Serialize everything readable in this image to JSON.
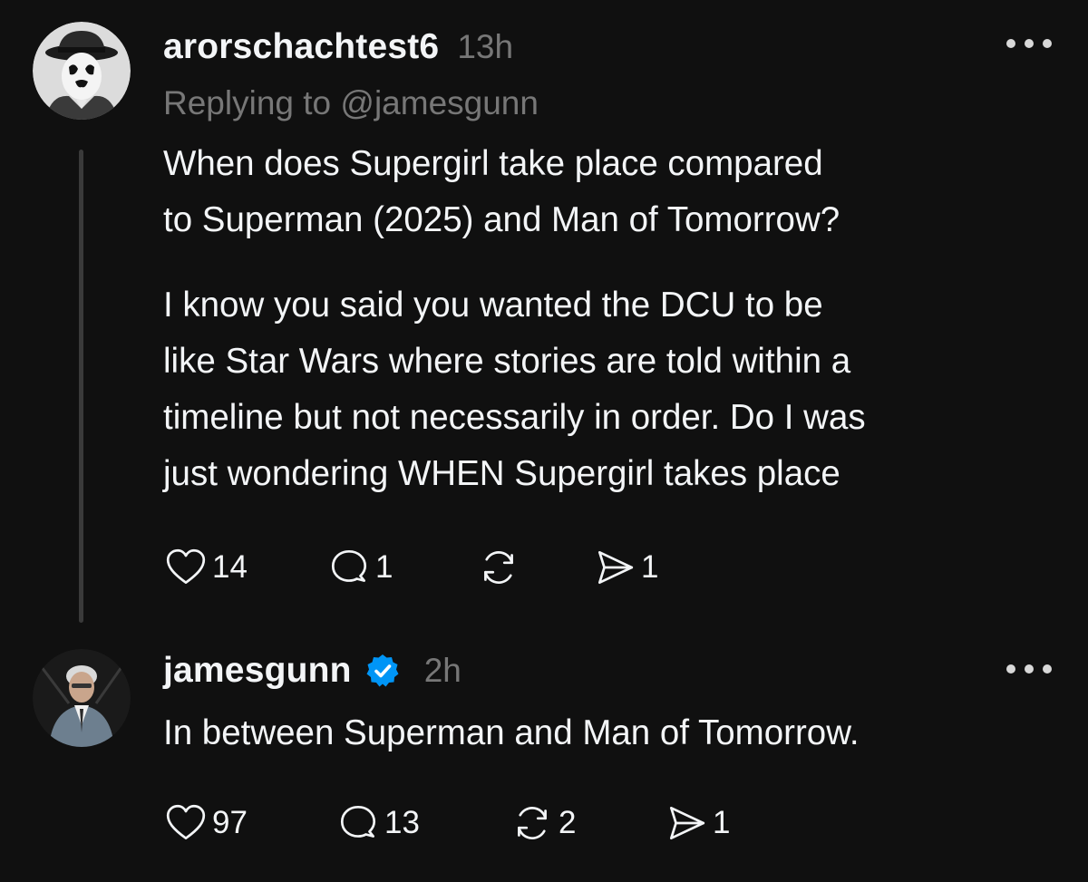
{
  "posts": [
    {
      "username": "arorschachtest6",
      "time": "13h",
      "replying_to": "Replying to @jamesgunn",
      "avatar_icon": "rorschach-avatar",
      "paragraphs": [
        [
          "When does Supergirl take place compared",
          "to Superman (2025) and Man of Tomorrow?"
        ],
        [
          "I know you said you wanted the DCU to be",
          "like Star Wars where stories are told within a",
          "timeline but not necessarily in order. Do I was",
          "just wondering WHEN Supergirl takes place"
        ]
      ],
      "likes": "14",
      "replies": "1",
      "reposts": "",
      "shares": "1"
    },
    {
      "username": "jamesgunn",
      "verified": true,
      "time": "2h",
      "avatar_icon": "profile-photo-avatar",
      "paragraphs": [
        [
          "In between Superman and Man of Tomorrow."
        ]
      ],
      "likes": "97",
      "replies": "13",
      "reposts": "2",
      "shares": "1"
    }
  ],
  "icons": {
    "like": "heart-icon",
    "reply": "speech-bubble-icon",
    "repost": "repost-arrows-icon",
    "share": "send-icon",
    "more": "more-options-icon",
    "verified": "verified-badge-icon"
  },
  "colors": {
    "background": "#101010",
    "text": "#f3f5f7",
    "muted": "#777777",
    "verified": "#0095f6",
    "thread_line": "#3a3a3a"
  }
}
